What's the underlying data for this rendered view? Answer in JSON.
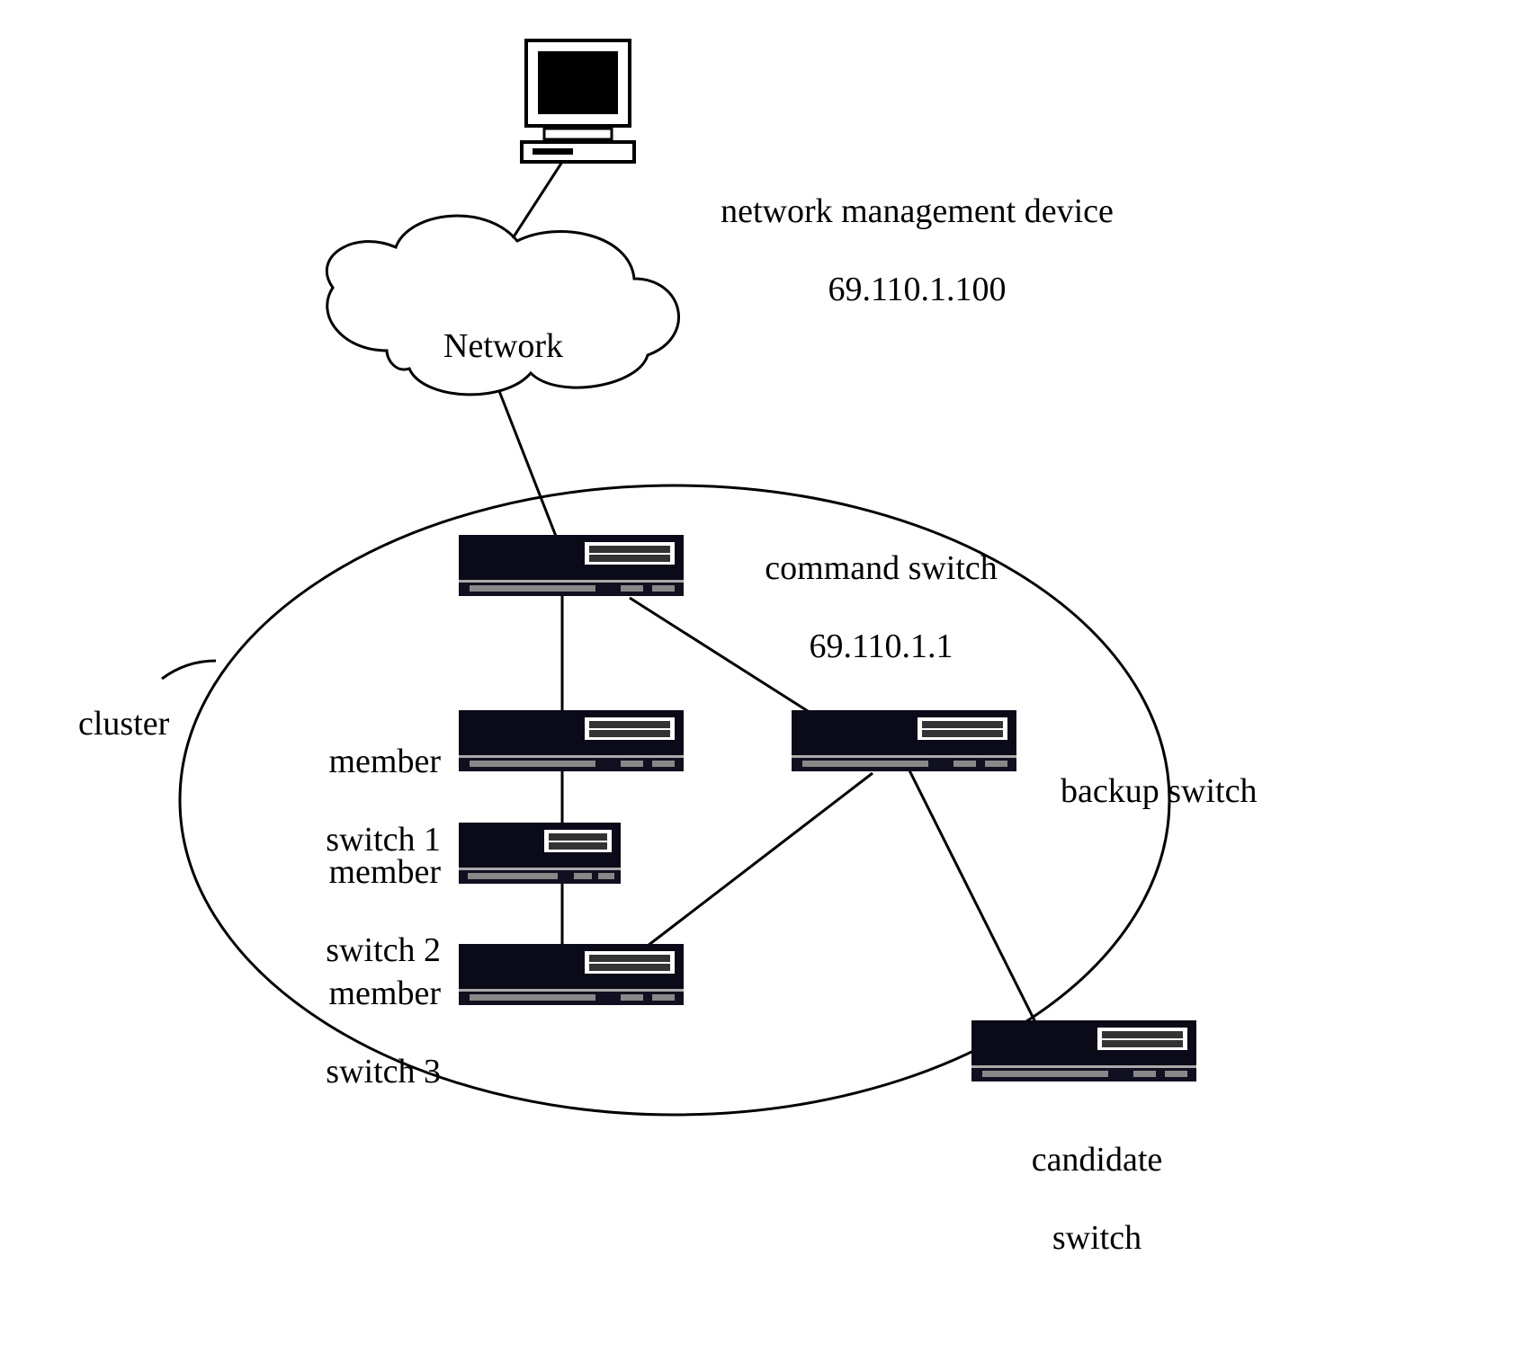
{
  "labels": {
    "nmd_line1": "network management device",
    "nmd_line2": "69.110.1.100",
    "network": "Network",
    "cluster": "cluster",
    "command_line1": "command switch",
    "command_line2": "69.110.1.1",
    "member1_line1": "member",
    "member1_line2": "switch 1",
    "member2_line1": "member",
    "member2_line2": "switch 2",
    "member3_line1": "member",
    "member3_line2": "switch 3",
    "backup": "backup switch",
    "candidate_line1": "candidate",
    "candidate_line2": "switch"
  }
}
